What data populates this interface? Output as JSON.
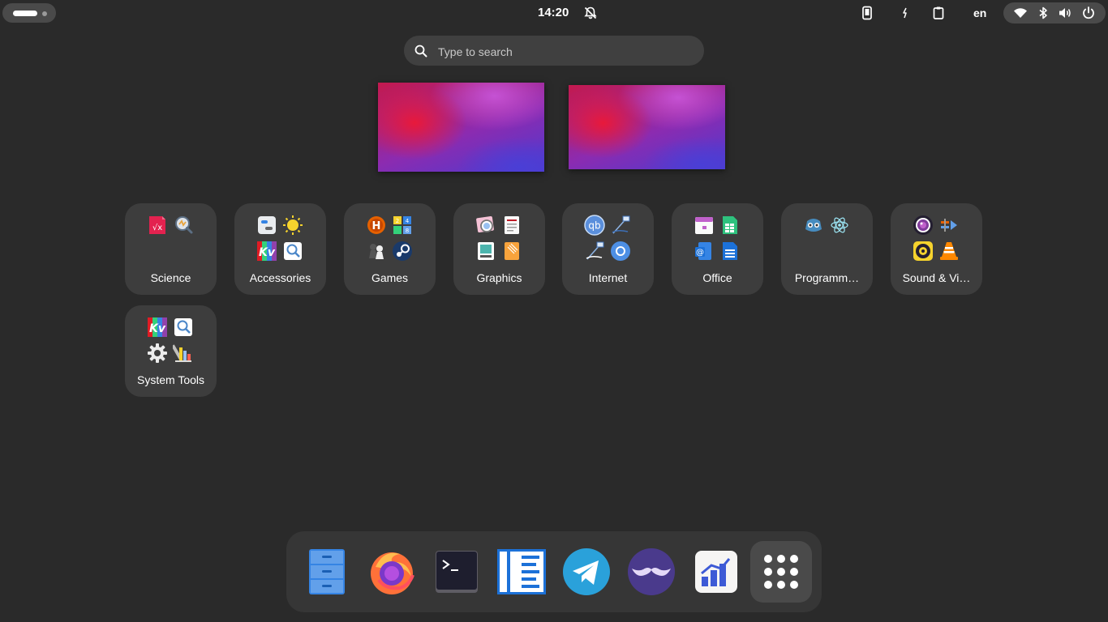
{
  "topbar": {
    "activities_icon": "activities-indicator",
    "clock": "14:20",
    "dnd_icon": "notifications-disabled-icon",
    "tray_icons": [
      "phone-icon",
      "power-mode-icon",
      "clipboard-icon"
    ],
    "language": "en",
    "system_icons": [
      "wifi-icon",
      "bluetooth-icon",
      "volume-icon",
      "power-icon"
    ]
  },
  "search": {
    "placeholder": "Type to search",
    "value": ""
  },
  "workspaces": [
    "workspace-1",
    "workspace-2"
  ],
  "folders": [
    {
      "label": "Science",
      "icons": [
        "calculator-icon",
        "magnifier-icon"
      ]
    },
    {
      "label": "Accessories",
      "icons": [
        "settings-toggle-icon",
        "weather-icon",
        "kvantum-icon",
        "search-doc-icon"
      ]
    },
    {
      "label": "Games",
      "icons": [
        "hedgewars-icon",
        "2048-icon",
        "chess-icon",
        "steam-icon"
      ]
    },
    {
      "label": "Graphics",
      "icons": [
        "image-viewer-icon",
        "document-scanner-icon",
        "photo-editor-icon",
        "notes-icon"
      ]
    },
    {
      "label": "Internet",
      "icons": [
        "qbittorrent-icon",
        "remote-desktop-icon",
        "remote-viewer-icon",
        "chromium-icon"
      ]
    },
    {
      "label": "Office",
      "icons": [
        "calendar-icon",
        "spreadsheet-icon",
        "email-icon",
        "document-icon"
      ]
    },
    {
      "label": "Programm…",
      "icons": [
        "godot-icon",
        "electron-icon"
      ]
    },
    {
      "label": "Sound & Vi…",
      "icons": [
        "camera-icon",
        "audio-converter-icon",
        "music-player-icon",
        "vlc-icon"
      ]
    },
    {
      "label": "System Tools",
      "icons": [
        "kvantum-manager-icon",
        "file-search-icon",
        "settings-gear-icon",
        "color-picker-icon"
      ]
    }
  ],
  "dash": {
    "apps": [
      "files-icon",
      "firefox-icon",
      "terminal-icon",
      "text-editor-icon",
      "telegram-icon",
      "mustache-icon",
      "analytics-icon"
    ],
    "show_apps_icon": "show-apps-grid-icon"
  }
}
